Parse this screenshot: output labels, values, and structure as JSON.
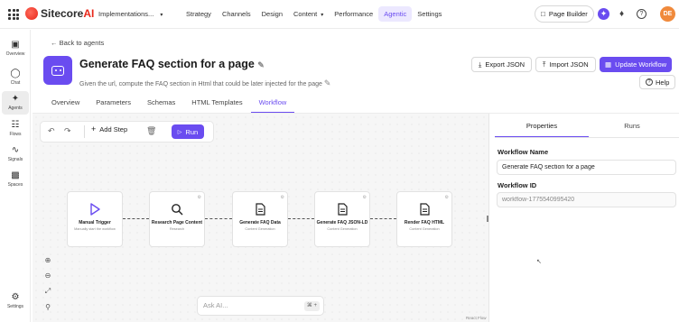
{
  "topbar": {
    "brand": "Sitecore",
    "brand_ai": "AI",
    "site_switcher": "Implementations...",
    "nav": [
      "Strategy",
      "Channels",
      "Design",
      "Content",
      "Performance",
      "Agentic",
      "Settings"
    ],
    "active_nav": "Agentic",
    "page_builder": "Page Builder",
    "avatar_initials": "DE"
  },
  "leftnav": [
    {
      "label": "Overview",
      "icon": "monitor-icon"
    },
    {
      "label": "Chat",
      "icon": "chat-icon"
    },
    {
      "label": "Agents",
      "icon": "sparkle-icon",
      "active": true
    },
    {
      "label": "Flows",
      "icon": "flows-icon"
    },
    {
      "label": "Signals",
      "icon": "signals-icon"
    },
    {
      "label": "Spaces",
      "icon": "spaces-icon"
    },
    {
      "label": "Settings",
      "icon": "gear-icon"
    }
  ],
  "header": {
    "back_link": "← Back to agents",
    "title": "Generate FAQ section for a page",
    "subtitle": "Given the url, compute the FAQ section in Html that could be later injected for the page",
    "export_label": "Export JSON",
    "import_label": "Import JSON",
    "update_label": "Update Workflow",
    "help_label": "Help"
  },
  "tabs": [
    "Overview",
    "Parameters",
    "Schemas",
    "HTML Templates",
    "Workflow"
  ],
  "active_tab": "Workflow",
  "toolbar": {
    "add_step": "Add Step",
    "run": "Run"
  },
  "nodes": [
    {
      "title": "Manual Trigger",
      "subtitle": "Manually start the workflow",
      "icon": "play-icon"
    },
    {
      "title": "Research Page Content",
      "subtitle": "Research",
      "icon": "search-icon"
    },
    {
      "title": "Generate FAQ Data",
      "subtitle": "Content Generation",
      "icon": "document-icon"
    },
    {
      "title": "Generate FAQ JSON-LD",
      "subtitle": "Content Generation",
      "icon": "document-icon"
    },
    {
      "title": "Render FAQ HTML",
      "subtitle": "Content Generation",
      "icon": "document-icon"
    }
  ],
  "ask_ai": {
    "placeholder": "Ask AI...",
    "shortcut": "⌘ +"
  },
  "attribution": "React Flow",
  "panel": {
    "tabs": [
      "Properties",
      "Runs"
    ],
    "active_tab": "Properties",
    "workflow_name_label": "Workflow Name",
    "workflow_name_value": "Generate FAQ section for a page",
    "workflow_id_label": "Workflow ID",
    "workflow_id_value": "workflow-1775540995420"
  },
  "colors": {
    "accent": "#6a4cf0",
    "brand_red": "#e8271a",
    "avatar": "#f08a3c"
  }
}
